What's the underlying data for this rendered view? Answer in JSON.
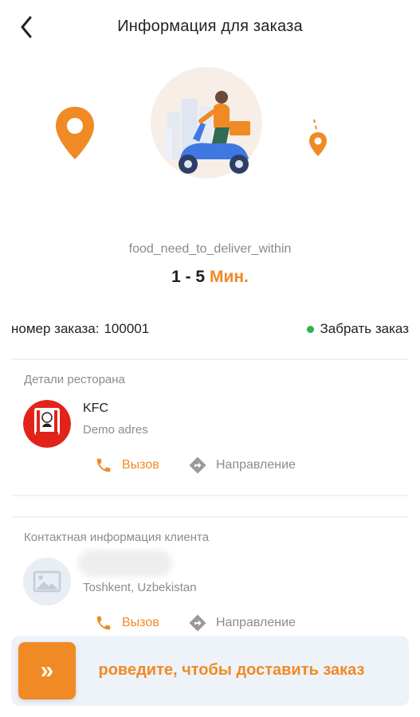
{
  "header": {
    "title": "Информация для заказа",
    "back_icon": "arrow-left-icon"
  },
  "delivery": {
    "label": "food_need_to_deliver_within",
    "time_value": "1 - 5",
    "time_unit": "Мин."
  },
  "order": {
    "number_label": "номер заказа:",
    "number": "100001",
    "status": "Забрать заказ",
    "status_color": "#2bb34b"
  },
  "restaurant": {
    "section_title": "Детали ресторана",
    "name": "KFC",
    "address": "Demo adres",
    "logo_text": "KFC",
    "call_label": "Вызов",
    "directions_label": "Направление"
  },
  "customer": {
    "section_title": "Контактная информация клиента",
    "address": "Toshkent, Uzbekistan",
    "call_label": "Вызов",
    "directions_label": "Направление"
  },
  "swipe": {
    "label": "роведите, чтобы доставить заказ",
    "handle_glyph": "»"
  },
  "colors": {
    "accent": "#f08a24",
    "status_green": "#2bb34b",
    "muted_text": "#8c8c8c",
    "swipe_bg": "#eef2f9"
  }
}
